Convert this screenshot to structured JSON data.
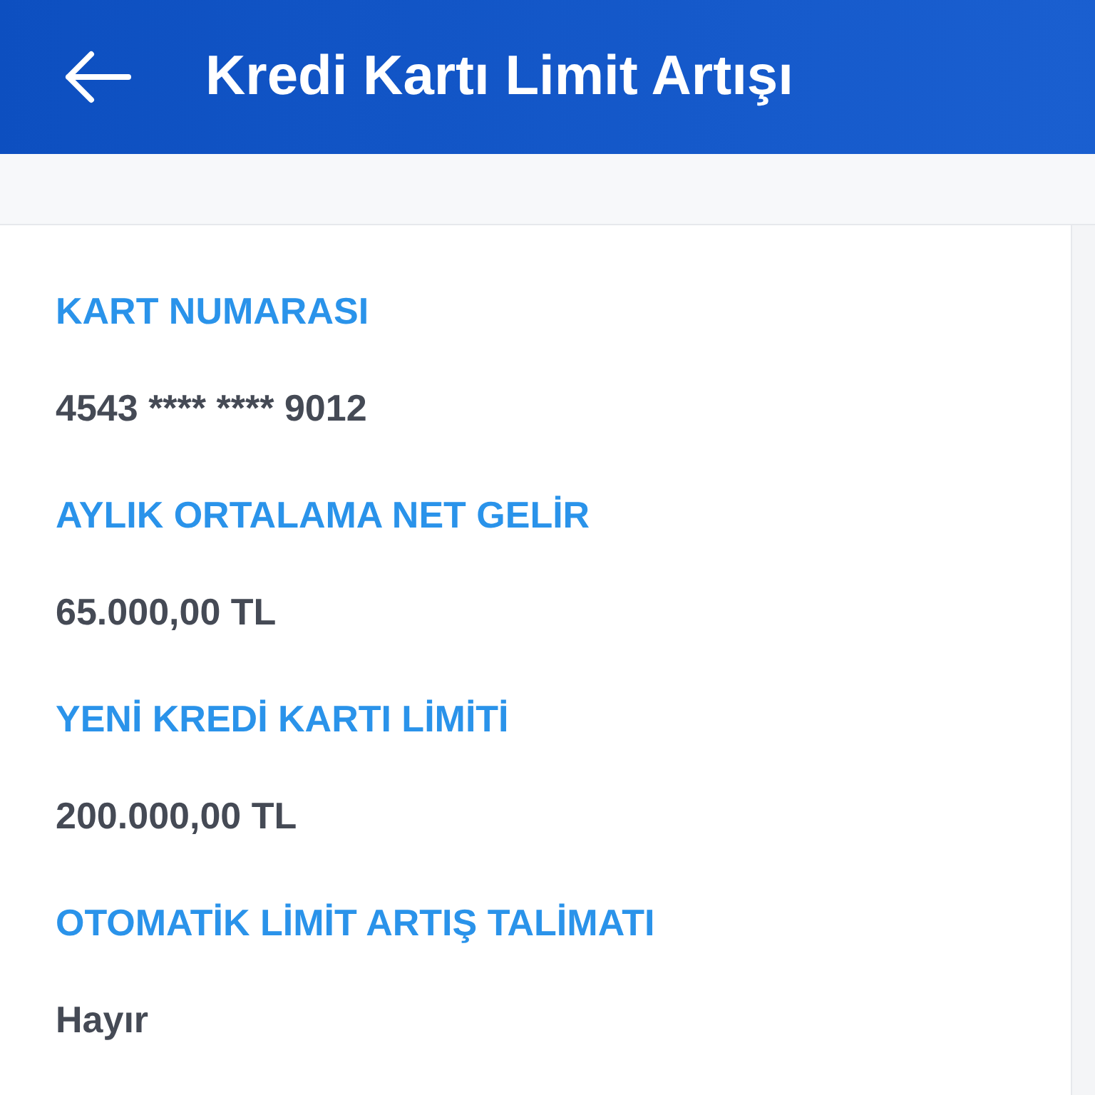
{
  "header": {
    "title": "Kredi Kartı Limit Artışı"
  },
  "fields": [
    {
      "label": "KART NUMARASI",
      "value": "4543 **** **** 9012"
    },
    {
      "label": "AYLIK ORTALAMA NET GELİR",
      "value": "65.000,00 TL"
    },
    {
      "label": "YENİ KREDİ KARTI LİMİTİ",
      "value": "200.000,00 TL"
    },
    {
      "label": "OTOMATİK LİMİT ARTIŞ TALİMATI",
      "value": "Hayır"
    }
  ]
}
